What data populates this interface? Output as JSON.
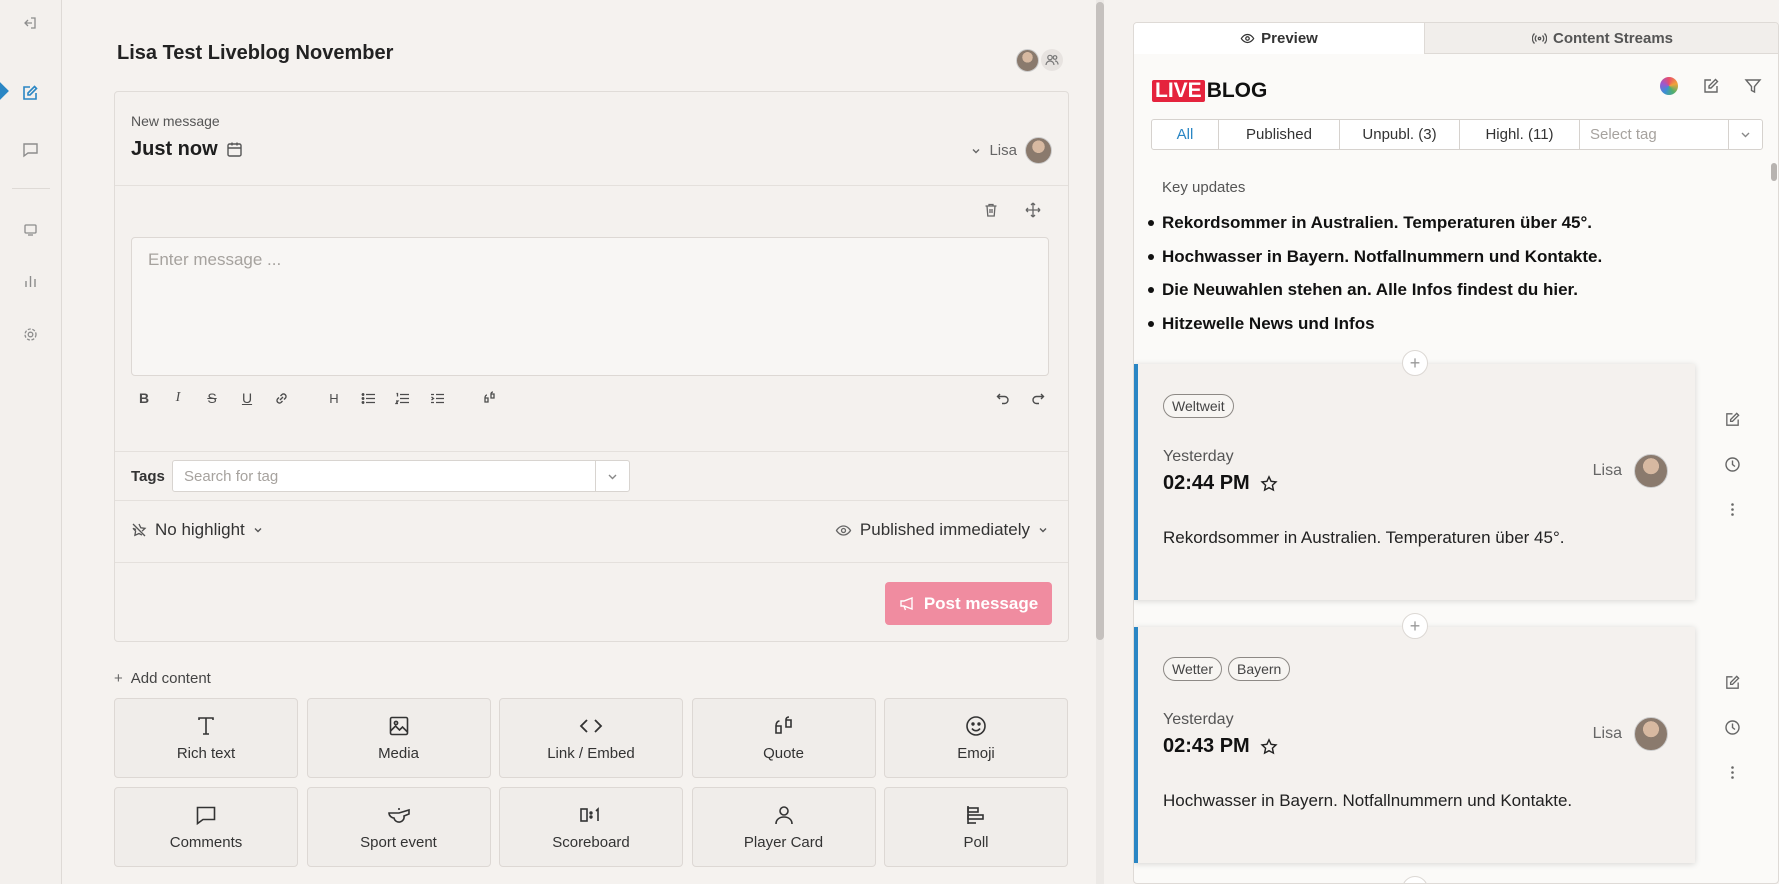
{
  "editor": {
    "title": "Lisa Test Liveblog November",
    "new_message_label": "New message",
    "time_label": "Just now",
    "author": "Lisa",
    "message_placeholder": "Enter message ...",
    "tags_label": "Tags",
    "tags_placeholder": "Search for tag",
    "highlight_label": "No highlight",
    "publish_label": "Published immediately",
    "post_button": "Post message",
    "add_content_label": "Add content",
    "content_blocks": [
      {
        "label": "Rich text",
        "icon": "text-icon"
      },
      {
        "label": "Media",
        "icon": "image-icon"
      },
      {
        "label": "Link / Embed",
        "icon": "code-icon"
      },
      {
        "label": "Quote",
        "icon": "quote-icon"
      },
      {
        "label": "Emoji",
        "icon": "emoji-icon"
      },
      {
        "label": "Comments",
        "icon": "comment-icon"
      },
      {
        "label": "Sport event",
        "icon": "whistle-icon"
      },
      {
        "label": "Scoreboard",
        "icon": "scoreboard-icon"
      },
      {
        "label": "Player Card",
        "icon": "person-icon"
      },
      {
        "label": "Poll",
        "icon": "poll-icon"
      }
    ]
  },
  "preview": {
    "tabs": [
      {
        "label": "Preview",
        "icon": "eye-icon"
      },
      {
        "label": "Content Streams",
        "icon": "stream-icon"
      }
    ],
    "logo_live": "LIVE",
    "logo_blog": "BLOG",
    "filters": [
      "All",
      "Published",
      "Unpubl. (3)",
      "Highl. (11)"
    ],
    "tag_select_placeholder": "Select tag",
    "key_updates_title": "Key updates",
    "key_updates": [
      "Rekordsommer in Australien. Temperaturen über 45°.",
      "Hochwasser in Bayern. Notfallnummern und Kontakte.",
      "Die Neuwahlen stehen an. Alle Infos findest du hier.",
      "Hitzewelle News und Infos"
    ],
    "posts": [
      {
        "tags": [
          "Weltweit"
        ],
        "day": "Yesterday",
        "time": "02:44 PM",
        "author": "Lisa",
        "text": "Rekordsommer in Australien. Temperaturen über 45°."
      },
      {
        "tags": [
          "Wetter",
          "Bayern"
        ],
        "day": "Yesterday",
        "time": "02:43 PM",
        "author": "Lisa",
        "text": "Hochwasser in Bayern. Notfallnummern und Kontakte."
      }
    ]
  },
  "colors": {
    "accent": "#2a86c4",
    "post_button": "#f08ca0",
    "logo_red": "#e5233d"
  }
}
